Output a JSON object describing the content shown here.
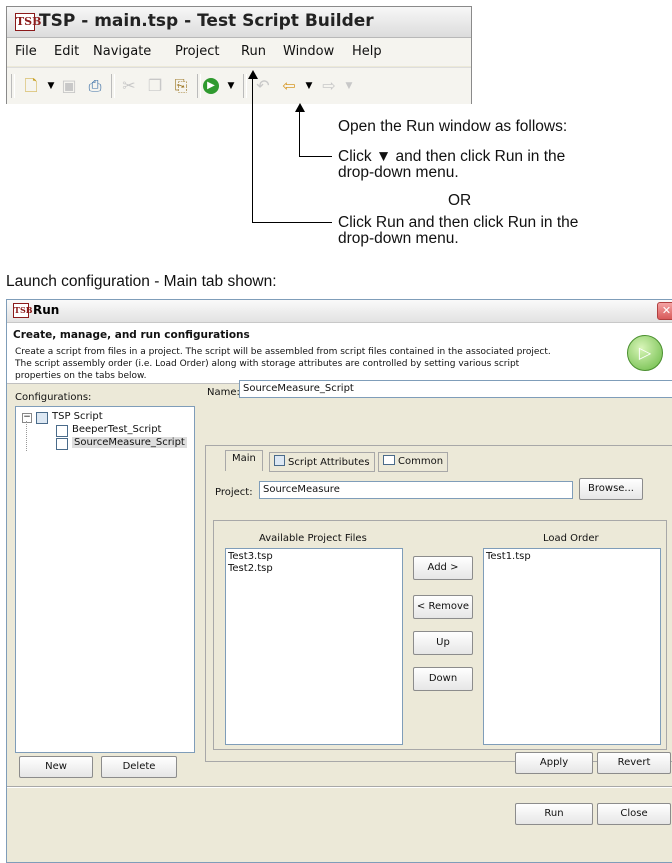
{
  "top_window": {
    "logo_text": "TSB",
    "title": "TSP - main.tsp - Test Script Builder",
    "menu": [
      "File",
      "Edit",
      "Navigate",
      "Project",
      "Run",
      "Window",
      "Help"
    ]
  },
  "annotations": {
    "intro": "Open the Run window as follows:",
    "option1_line1": "Click ▼ and then click Run in the",
    "option1_line2": "drop-down menu.",
    "or": "OR",
    "option2_line1": "Click Run and then click Run in the",
    "option2_line2": "drop-down menu.",
    "caption": "Launch configuration - Main tab shown:"
  },
  "dialog": {
    "logo_text": "TSB",
    "title": "Run",
    "banner_title": "Create, manage, and run configurations",
    "banner_desc": [
      "Create a script from files in a project.  The script will be assembled from script files contained in the associated project.",
      "The script assembly order (i.e. Load Order) along with storage attributes are controlled by setting various script",
      "properties on the tabs below."
    ],
    "configurations_label": "Configurations:",
    "tree": {
      "root": "TSP Script",
      "children": [
        "BeeperTest_Script",
        "SourceMeasure_Script"
      ]
    },
    "name_label": "Name:",
    "name_value": "SourceMeasure_Script",
    "tabs": [
      "Main",
      "Script Attributes",
      "Common"
    ],
    "project_label": "Project:",
    "project_value": "SourceMeasure",
    "browse_label": "Browse...",
    "available_label": "Available Project Files",
    "available_files": [
      "Test3.tsp",
      "Test2.tsp"
    ],
    "load_order_label": "Load Order",
    "load_order_files": [
      "Test1.tsp"
    ],
    "add_label": "Add >",
    "remove_label": "< Remove",
    "up_label": "Up",
    "down_label": "Down",
    "new_label": "New",
    "delete_label": "Delete",
    "apply_label": "Apply",
    "revert_label": "Revert",
    "run_label": "Run",
    "close_label": "Close"
  }
}
